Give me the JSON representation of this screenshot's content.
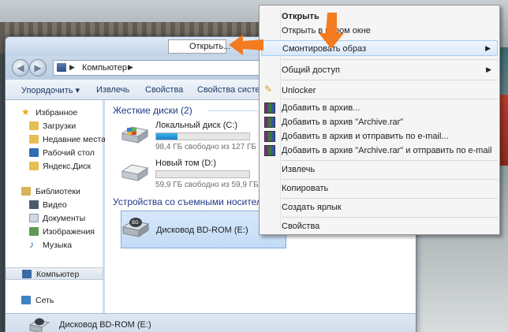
{
  "explorer": {
    "address": {
      "text": "Компьютер"
    },
    "toolbar": [
      "Упорядочить ▾",
      "Извлечь",
      "Свойства",
      "Свойства системы"
    ],
    "nav": [
      {
        "label": "Избранное",
        "icon": "star-icon"
      },
      {
        "label": "Загрузки",
        "icon": "folder-icon"
      },
      {
        "label": "Недавние места",
        "icon": "folder-icon"
      },
      {
        "label": "Рабочий стол",
        "icon": "desktop-icon"
      },
      {
        "label": "Яндекс.Диск",
        "icon": "folder-icon"
      },
      {
        "label": "Библиотеки",
        "icon": "library-icon"
      },
      {
        "label": "Видео",
        "icon": "video-icon"
      },
      {
        "label": "Документы",
        "icon": "documents-icon"
      },
      {
        "label": "Изображения",
        "icon": "pictures-icon"
      },
      {
        "label": "Музыка",
        "icon": "music-icon"
      },
      {
        "label": "Компьютер",
        "icon": "computer-icon"
      },
      {
        "label": "Сеть",
        "icon": "network-icon"
      }
    ],
    "groups": {
      "hdd": "Жесткие диски (2)",
      "removable": "Устройства со съемными носителями"
    },
    "drives": [
      {
        "name": "Локальный диск (C:)",
        "free": "98,4 ГБ свободно из 127 ГБ",
        "used_fraction": 0.23
      },
      {
        "name": "Новый том (D:)",
        "free": "59,9 ГБ свободно из 59,9 ГБ",
        "used_fraction": 0.0
      },
      {
        "name": "Дисковод BD-ROM (E:)"
      }
    ],
    "status": {
      "name": "Дисковод BD-ROM (E:)"
    }
  },
  "open_label": "Открыть...",
  "menu": {
    "items": [
      "Открыть",
      "Открыть в новом окне",
      "Смонтировать образ",
      "Общий доступ",
      "Unlocker",
      "Добавить в архив...",
      "Добавить в архив \"Archive.rar\"",
      "Добавить в архив и отправить по e-mail...",
      "Добавить в архив \"Archive.rar\" и отправить по e-mail",
      "Извлечь",
      "Копировать",
      "Создать ярлык",
      "Свойства"
    ]
  },
  "colors": {
    "arrow": "#f47b20",
    "link": "#1e3a8a"
  }
}
